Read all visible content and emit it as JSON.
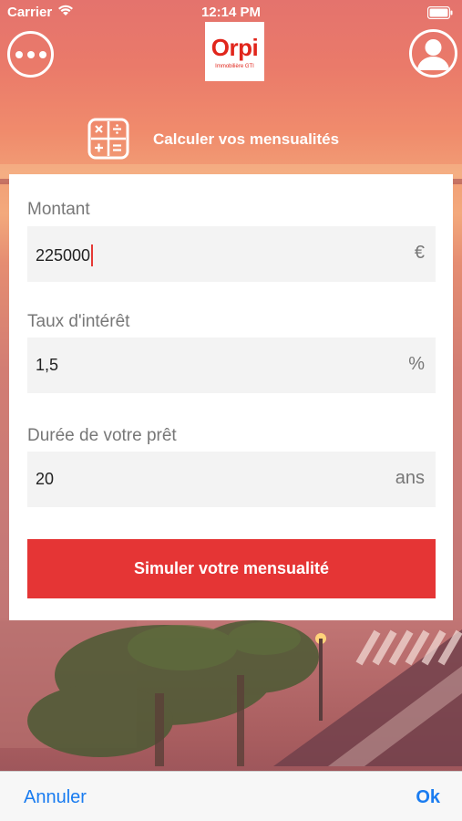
{
  "status_bar": {
    "carrier": "Carrier",
    "time": "12:14 PM"
  },
  "header": {
    "logo_word": "Orpi",
    "logo_subtitle": "Immobilière GTI"
  },
  "calculator": {
    "title": "Calculer vos mensualités",
    "fields": [
      {
        "label": "Montant",
        "value": "225000",
        "unit": "€"
      },
      {
        "label": "Taux d'intérêt",
        "value": "1,5",
        "unit": "%"
      },
      {
        "label": "Durée de votre prêt",
        "value": "20",
        "unit": "ans"
      }
    ],
    "submit_label": "Simuler votre mensualité"
  },
  "toolbar": {
    "cancel_label": "Annuler",
    "ok_label": "Ok"
  },
  "colors": {
    "accent_red": "#e53535",
    "ios_blue": "#1a7cf0",
    "caret": "#e53935"
  },
  "icons": [
    "wifi-icon",
    "battery-icon",
    "more-icon",
    "profile-icon",
    "calculator-icon"
  ]
}
